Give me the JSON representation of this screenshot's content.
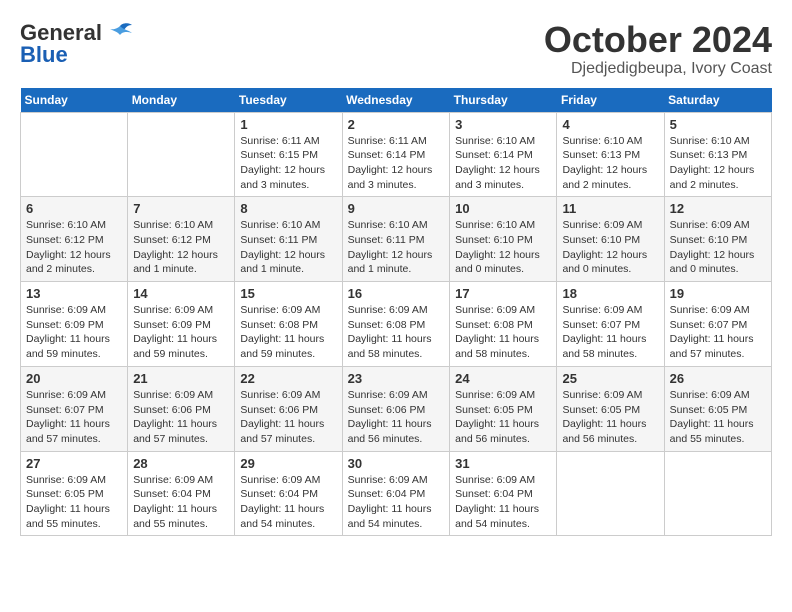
{
  "logo": {
    "general": "General",
    "blue": "Blue"
  },
  "title": {
    "month": "October 2024",
    "location": "Djedjedigbeupa, Ivory Coast"
  },
  "weekdays": [
    "Sunday",
    "Monday",
    "Tuesday",
    "Wednesday",
    "Thursday",
    "Friday",
    "Saturday"
  ],
  "weeks": [
    [
      {
        "day": "",
        "info": ""
      },
      {
        "day": "",
        "info": ""
      },
      {
        "day": "1",
        "info": "Sunrise: 6:11 AM\nSunset: 6:15 PM\nDaylight: 12 hours and 3 minutes."
      },
      {
        "day": "2",
        "info": "Sunrise: 6:11 AM\nSunset: 6:14 PM\nDaylight: 12 hours and 3 minutes."
      },
      {
        "day": "3",
        "info": "Sunrise: 6:10 AM\nSunset: 6:14 PM\nDaylight: 12 hours and 3 minutes."
      },
      {
        "day": "4",
        "info": "Sunrise: 6:10 AM\nSunset: 6:13 PM\nDaylight: 12 hours and 2 minutes."
      },
      {
        "day": "5",
        "info": "Sunrise: 6:10 AM\nSunset: 6:13 PM\nDaylight: 12 hours and 2 minutes."
      }
    ],
    [
      {
        "day": "6",
        "info": "Sunrise: 6:10 AM\nSunset: 6:12 PM\nDaylight: 12 hours and 2 minutes."
      },
      {
        "day": "7",
        "info": "Sunrise: 6:10 AM\nSunset: 6:12 PM\nDaylight: 12 hours and 1 minute."
      },
      {
        "day": "8",
        "info": "Sunrise: 6:10 AM\nSunset: 6:11 PM\nDaylight: 12 hours and 1 minute."
      },
      {
        "day": "9",
        "info": "Sunrise: 6:10 AM\nSunset: 6:11 PM\nDaylight: 12 hours and 1 minute."
      },
      {
        "day": "10",
        "info": "Sunrise: 6:10 AM\nSunset: 6:10 PM\nDaylight: 12 hours and 0 minutes."
      },
      {
        "day": "11",
        "info": "Sunrise: 6:09 AM\nSunset: 6:10 PM\nDaylight: 12 hours and 0 minutes."
      },
      {
        "day": "12",
        "info": "Sunrise: 6:09 AM\nSunset: 6:10 PM\nDaylight: 12 hours and 0 minutes."
      }
    ],
    [
      {
        "day": "13",
        "info": "Sunrise: 6:09 AM\nSunset: 6:09 PM\nDaylight: 11 hours and 59 minutes."
      },
      {
        "day": "14",
        "info": "Sunrise: 6:09 AM\nSunset: 6:09 PM\nDaylight: 11 hours and 59 minutes."
      },
      {
        "day": "15",
        "info": "Sunrise: 6:09 AM\nSunset: 6:08 PM\nDaylight: 11 hours and 59 minutes."
      },
      {
        "day": "16",
        "info": "Sunrise: 6:09 AM\nSunset: 6:08 PM\nDaylight: 11 hours and 58 minutes."
      },
      {
        "day": "17",
        "info": "Sunrise: 6:09 AM\nSunset: 6:08 PM\nDaylight: 11 hours and 58 minutes."
      },
      {
        "day": "18",
        "info": "Sunrise: 6:09 AM\nSunset: 6:07 PM\nDaylight: 11 hours and 58 minutes."
      },
      {
        "day": "19",
        "info": "Sunrise: 6:09 AM\nSunset: 6:07 PM\nDaylight: 11 hours and 57 minutes."
      }
    ],
    [
      {
        "day": "20",
        "info": "Sunrise: 6:09 AM\nSunset: 6:07 PM\nDaylight: 11 hours and 57 minutes."
      },
      {
        "day": "21",
        "info": "Sunrise: 6:09 AM\nSunset: 6:06 PM\nDaylight: 11 hours and 57 minutes."
      },
      {
        "day": "22",
        "info": "Sunrise: 6:09 AM\nSunset: 6:06 PM\nDaylight: 11 hours and 57 minutes."
      },
      {
        "day": "23",
        "info": "Sunrise: 6:09 AM\nSunset: 6:06 PM\nDaylight: 11 hours and 56 minutes."
      },
      {
        "day": "24",
        "info": "Sunrise: 6:09 AM\nSunset: 6:05 PM\nDaylight: 11 hours and 56 minutes."
      },
      {
        "day": "25",
        "info": "Sunrise: 6:09 AM\nSunset: 6:05 PM\nDaylight: 11 hours and 56 minutes."
      },
      {
        "day": "26",
        "info": "Sunrise: 6:09 AM\nSunset: 6:05 PM\nDaylight: 11 hours and 55 minutes."
      }
    ],
    [
      {
        "day": "27",
        "info": "Sunrise: 6:09 AM\nSunset: 6:05 PM\nDaylight: 11 hours and 55 minutes."
      },
      {
        "day": "28",
        "info": "Sunrise: 6:09 AM\nSunset: 6:04 PM\nDaylight: 11 hours and 55 minutes."
      },
      {
        "day": "29",
        "info": "Sunrise: 6:09 AM\nSunset: 6:04 PM\nDaylight: 11 hours and 54 minutes."
      },
      {
        "day": "30",
        "info": "Sunrise: 6:09 AM\nSunset: 6:04 PM\nDaylight: 11 hours and 54 minutes."
      },
      {
        "day": "31",
        "info": "Sunrise: 6:09 AM\nSunset: 6:04 PM\nDaylight: 11 hours and 54 minutes."
      },
      {
        "day": "",
        "info": ""
      },
      {
        "day": "",
        "info": ""
      }
    ]
  ]
}
